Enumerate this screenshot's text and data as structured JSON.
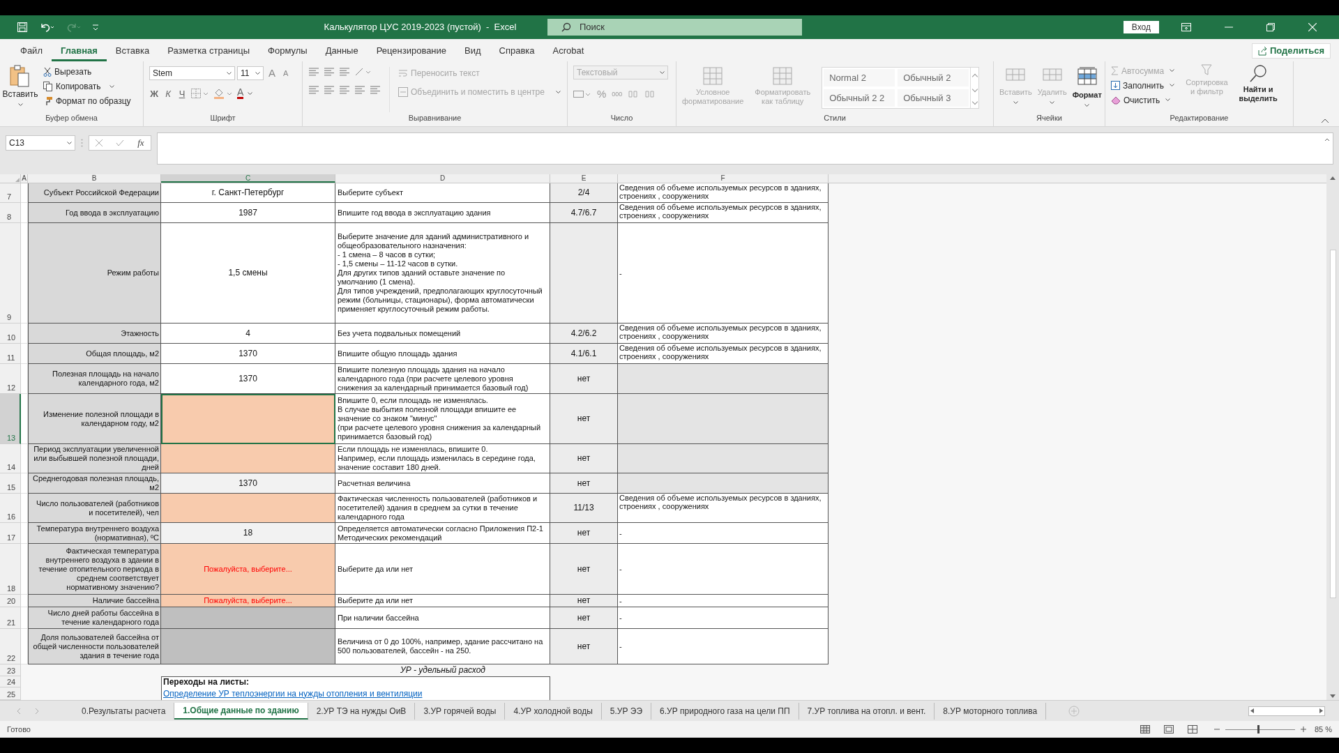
{
  "window": {
    "title": "Калькулятор ЦУС 2019-2023 (пустой)  -  Excel",
    "search_placeholder": "Поиск",
    "sign_in": "Вход"
  },
  "menu_tabs": [
    {
      "label": "Файл",
      "selected": false
    },
    {
      "label": "Главная",
      "selected": true
    },
    {
      "label": "Вставка",
      "selected": false
    },
    {
      "label": "Разметка страницы",
      "selected": false
    },
    {
      "label": "Формулы",
      "selected": false
    },
    {
      "label": "Данные",
      "selected": false
    },
    {
      "label": "Рецензирование",
      "selected": false
    },
    {
      "label": "Вид",
      "selected": false
    },
    {
      "label": "Справка",
      "selected": false
    },
    {
      "label": "Acrobat",
      "selected": false
    }
  ],
  "share": "Поделиться",
  "ribbon": {
    "clipboard": {
      "label": "Буфер обмена",
      "paste": "Вставить",
      "cut": "Вырезать",
      "copy": "Копировать",
      "format_painter": "Формат по образцу"
    },
    "font": {
      "label": "Шрифт",
      "font_name": "Stem",
      "font_size": "11",
      "grow": "A",
      "shrink": "A",
      "bold": "Ж",
      "italic": "К",
      "underline": "Ч",
      "font_color_label": "A"
    },
    "alignment": {
      "label": "Выравнивание",
      "wrap_text": {
        "label": "Переносить текст",
        "disabled": true
      },
      "merge": {
        "label": "Объединить и поместить в центре",
        "disabled": true
      }
    },
    "number": {
      "label": "Число",
      "format": {
        "label": "Текстовый",
        "disabled": true
      },
      "percent": "%",
      "thousands": "000"
    },
    "styles": {
      "label": "Стили",
      "conditional": {
        "label": "Условное\nформатирование",
        "disabled": true
      },
      "format_table": {
        "label": "Форматировать\nкак таблицу",
        "disabled": true
      },
      "gallery": [
        "Normal 2",
        "Обычный 2",
        "Обычный 2 2",
        "Обычный 3"
      ]
    },
    "cells": {
      "label": "Ячейки",
      "items": [
        {
          "label": "Вставить",
          "disabled": true
        },
        {
          "label": "Удалить",
          "disabled": true
        },
        {
          "label": "Формат",
          "disabled": false
        }
      ]
    },
    "editing": {
      "label": "Редактирование",
      "items": [
        {
          "label": "Автосумма",
          "disabled": true
        },
        {
          "label": "Заполнить",
          "disabled": false
        },
        {
          "label": "Очистить",
          "disabled": false
        }
      ],
      "sort": {
        "label": "Сортировка\nи фильтр",
        "disabled": true
      },
      "find": {
        "label": "Найти и\nвыделить",
        "disabled": false
      }
    }
  },
  "formula_bar": {
    "name_box": "C13",
    "function_symbol": "fx"
  },
  "columns": [
    {
      "label": "A",
      "selected": false
    },
    {
      "label": "B",
      "selected": false
    },
    {
      "label": "C",
      "selected": true
    },
    {
      "label": "D",
      "selected": false
    },
    {
      "label": "E",
      "selected": false
    },
    {
      "label": "F",
      "selected": false
    }
  ],
  "rows": [
    {
      "number": "7",
      "selected": false,
      "label": "Субъект Российской Федерации",
      "value": {
        "kind": "value",
        "text": "г. Санкт-Петербург"
      },
      "hint": "Выберите субъект",
      "ref": "2/4",
      "source": "Сведения об объеме используемых ресурсов в зданиях,\nстроениях , сооружениях"
    },
    {
      "number": "8",
      "selected": false,
      "label": "Год ввода в эксплуатацию",
      "value": {
        "kind": "value",
        "text": "1987"
      },
      "hint": "Впишите год ввода в эксплуатацию здания",
      "ref": "4.7/6.7",
      "source": "Сведения об объеме используемых ресурсов в зданиях,\nстроениях , сооружениях"
    },
    {
      "number": "9",
      "selected": false,
      "label": "Режим работы",
      "value": {
        "kind": "value",
        "text": "1,5 смены"
      },
      "hint": "Выберите значение для зданий административного и\nобщеобразовательного назначения:\n- 1 смена – 8 часов в сутки;\n- 1,5 смены – 11-12 часов в сутки.\nДля других типов зданий оставьте значение по\nумолчанию (1 смена).\nДля типов учреждений, предполагающих круглосуточный\nрежим (больницы, стационары), форма автоматически\nприменяет круглосуточный режим работы.",
      "source": "-"
    },
    {
      "number": "10",
      "selected": false,
      "label": "Этажность",
      "value": {
        "kind": "value",
        "text": "4"
      },
      "hint": "Без учета подвальных помещений",
      "ref": "4.2/6.2",
      "source": "Сведения об объеме используемых ресурсов в зданиях,\nстроениях , сооружениях"
    },
    {
      "number": "11",
      "selected": false,
      "label": "Общая площадь, м2",
      "value": {
        "kind": "value",
        "text": "1370"
      },
      "hint": "Впишите общую площадь здания",
      "ref": "4.1/6.1",
      "source": "Сведения об объеме используемых ресурсов в зданиях,\nстроениях , сооружениях"
    },
    {
      "number": "12",
      "selected": false,
      "label": "Полезная площадь на начало\nкалендарного года, м2",
      "value": {
        "kind": "value",
        "text": "1370"
      },
      "hint": "Впишите полезную площадь здания на начало\nкалендарного года (при расчете целевого уровня\nснижения за календарный принимается базовый год)",
      "ref": "нет"
    },
    {
      "number": "13",
      "selected": true,
      "label": "Изменение полезной площади в\nкалендарном году, м2",
      "value": {
        "kind": "input"
      },
      "hint": "Впишите 0, если площадь не изменялась.\nВ случае выбытия полезной площади впишите ее\nзначение со знаком \"минус\"\n(при расчете целевого уровня снижения за календарный\nпринимается базовый год)",
      "ref": "нет"
    },
    {
      "number": "14",
      "selected": false,
      "label": "Период эксплуатации увеличенной\nили выбывшей полезной площади,\nдней",
      "value": {
        "kind": "input"
      },
      "hint": "Если площадь не изменялась, впишите 0.\nНапример, если площадь изменилась в середине года,\nзначение составит 180 дней.",
      "ref": "нет"
    },
    {
      "number": "15",
      "selected": false,
      "label": "Среднегодовая полезная площадь,\nм2",
      "value": {
        "kind": "calculated",
        "text": "1370"
      },
      "hint": "Расчетная величина",
      "ref": "нет"
    },
    {
      "number": "16",
      "selected": false,
      "label": "Число пользователей (работников\nи посетителей), чел",
      "value": {
        "kind": "input"
      },
      "hint": "Фактическая численность пользователей (работников и\nпосетителей) здания в среднем за сутки в течение\nкалендарного года",
      "ref": "11/13",
      "source": "Сведения об объеме используемых ресурсов в зданиях,\nстроениях , сооружениях"
    },
    {
      "number": "17",
      "selected": false,
      "label": "Температура внутреннего воздуха\n(нормативная), ºС",
      "value": {
        "kind": "calculated",
        "text": "18"
      },
      "hint": "Определяется автоматически согласно Приложения П2-1\nМетодических рекомендаций",
      "ref": "нет",
      "source": "-"
    },
    {
      "number": "18",
      "selected": false,
      "label": "Фактическая температура\nвнутреннего воздуха в здании в\nтечение отопительного периода в\nсреднем соответствует\nнормативному значению?",
      "value": {
        "kind": "prompt",
        "text": "Пожалуйста, выберите..."
      },
      "hint": "Выберите да или нет",
      "ref": "нет",
      "source": "-"
    },
    {
      "number": "20",
      "selected": false,
      "label": "Наличие бассейна",
      "value": {
        "kind": "prompt",
        "text": "Пожалуйста, выберите..."
      },
      "hint": "Выберите да или нет",
      "ref": "нет",
      "source": "-"
    },
    {
      "number": "21",
      "selected": false,
      "label": "Число дней работы бассейна в\nтечение календарного года",
      "value": {
        "kind": "disabled"
      },
      "hint": "При наличии бассейна",
      "ref": "нет",
      "source": "-"
    },
    {
      "number": "22",
      "selected": false,
      "label": "Доля пользователей бассейна от\nобщей численности пользователей\nздания в течение года",
      "value": {
        "kind": "disabled"
      },
      "hint": "Величина от 0 до 100%, например, здание рассчитано на\n500 пользователей, бассейн - на 250.",
      "ref": "нет",
      "source": "-"
    }
  ],
  "footer": {
    "row_numbers": [
      "23",
      "24",
      "25"
    ],
    "note": "УР - удельный расход",
    "links_title": "Переходы на листы:",
    "links": [
      "Определение УР теплоэнергии на нужды отопления и вентиляции"
    ]
  },
  "sheet_tabs": [
    {
      "label": "0.Результаты расчета",
      "selected": false
    },
    {
      "label": "1.Общие данные по зданию",
      "selected": true
    },
    {
      "label": "2.УР ТЭ на нужды ОиВ",
      "selected": false
    },
    {
      "label": "3.УР горячей воды",
      "selected": false
    },
    {
      "label": "4.УР холодной воды",
      "selected": false
    },
    {
      "label": "5.УР ЭЭ",
      "selected": false
    },
    {
      "label": "6.УР природного газа на цели ПП",
      "selected": false
    },
    {
      "label": "7.УР топлива на отопл. и вент.",
      "selected": false
    },
    {
      "label": "8.УР моторного топлива",
      "selected": false
    }
  ],
  "status_bar": {
    "status": "Готово",
    "zoom": "85 %",
    "zoom_level": {
      "level": 0.47
    }
  }
}
